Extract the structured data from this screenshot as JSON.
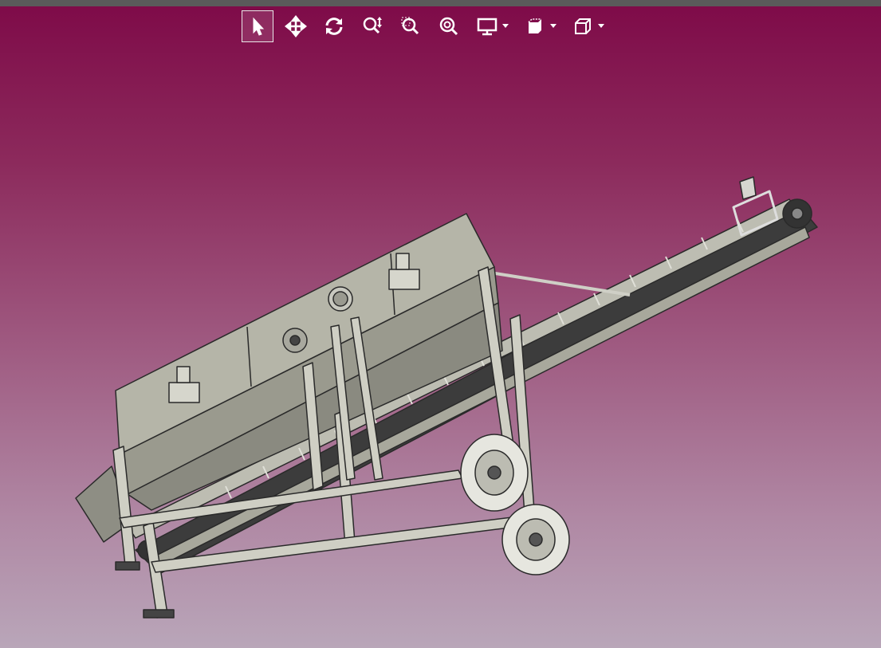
{
  "viewer": {
    "background_top": "#7e0a48",
    "background_bottom": "#b9a6b9",
    "model_color": "#b5b5a8"
  },
  "toolbar": {
    "buttons": [
      {
        "icon": "select-pointer-icon",
        "active": true
      },
      {
        "icon": "pan-move-icon",
        "active": false
      },
      {
        "icon": "rotate-icon",
        "active": false
      },
      {
        "icon": "zoom-in-out-icon",
        "active": false
      },
      {
        "icon": "zoom-window-icon",
        "active": false
      },
      {
        "icon": "zoom-fit-icon",
        "active": false
      },
      {
        "icon": "display-mode-icon",
        "active": false,
        "dropdown": true
      },
      {
        "icon": "section-view-icon",
        "active": false,
        "dropdown": true
      },
      {
        "icon": "view-cube-icon",
        "active": false,
        "dropdown": true
      }
    ]
  }
}
